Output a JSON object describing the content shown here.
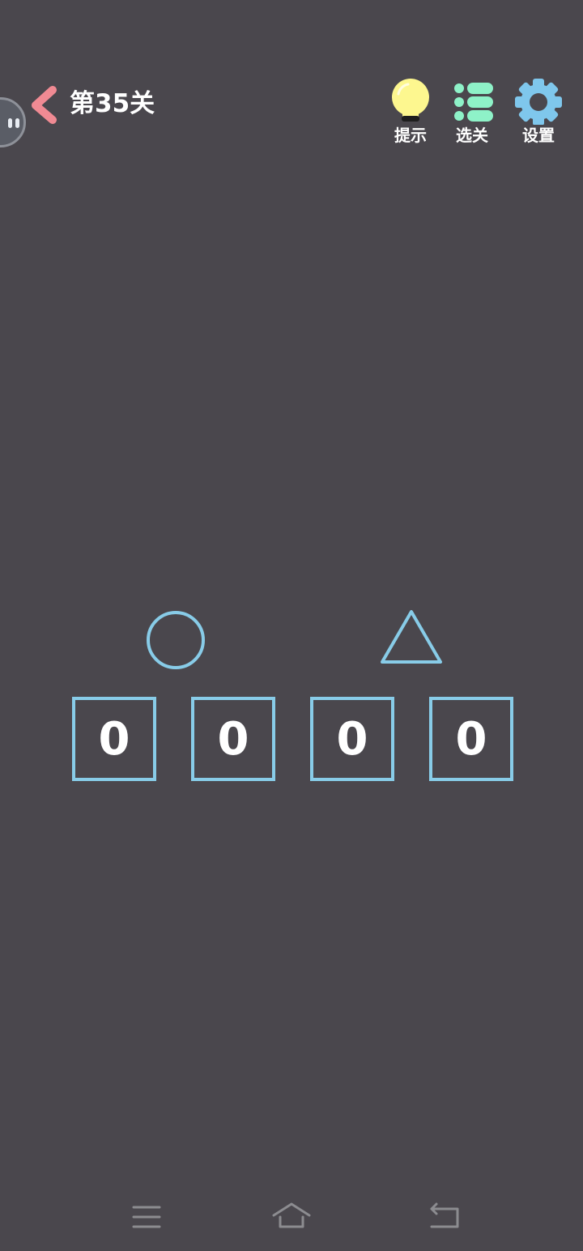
{
  "header": {
    "level_title": "第35关",
    "tools": [
      {
        "label": "提示",
        "icon": "lightbulb-icon"
      },
      {
        "label": "选关",
        "icon": "list-icon"
      },
      {
        "label": "设置",
        "icon": "gear-icon"
      }
    ]
  },
  "puzzle": {
    "symbols": [
      "circle",
      "triangle"
    ],
    "digits": [
      "0",
      "0",
      "0",
      "0"
    ]
  },
  "colors": {
    "background": "#4a474d",
    "accent_blue": "#88cce8",
    "back_arrow": "#f08a93",
    "bulb": "#fdf78f",
    "list": "#8ef2c8",
    "gear": "#7fc7ec"
  },
  "navbar": {
    "buttons": [
      "menu-icon",
      "home-icon",
      "back-icon"
    ]
  }
}
